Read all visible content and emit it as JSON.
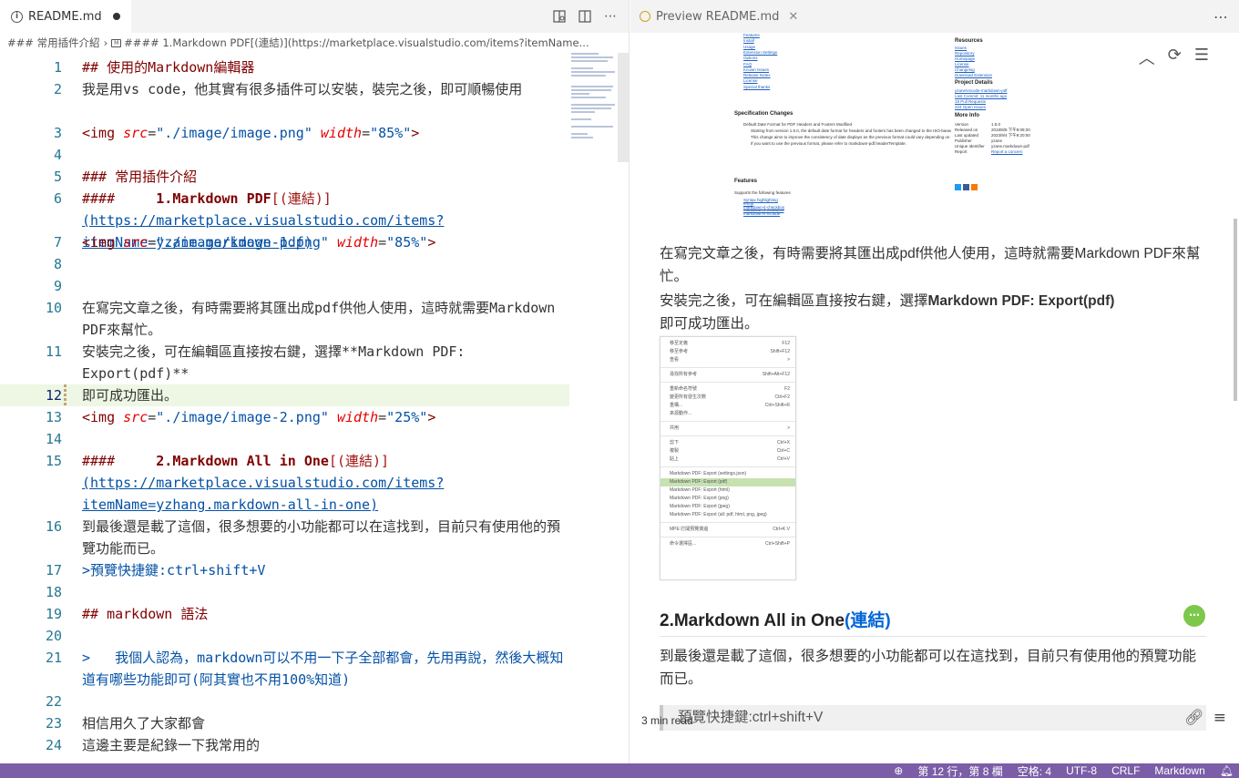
{
  "editor": {
    "tab_label": "README.md",
    "breadcrumb": {
      "part1": "### 常用插件介紹",
      "part2": "#### 1.Markdown PDF[(連結)](https://marketplace.visualstudio.com/items?itemName..."
    },
    "lines": [
      {
        "n": "1",
        "k": "## ",
        "t": "使用的Markdown編輯器"
      },
      {
        "n": "2",
        "t": "我是用vs code，他其實有很多插件可以安裝，裝完之後，即可順暢使用"
      },
      {
        "n": "3",
        "tag": "<img",
        "a1": "src",
        "v1": "\"./image/image.png\"",
        "a2": "width",
        "v2": "\"85%\"",
        "end": ">"
      },
      {
        "n": "4"
      },
      {
        "n": "5",
        "k": "### ",
        "t": "常用插件介紹"
      },
      {
        "n": "6",
        "k": "####     ",
        "h": "1.Markdown PDF",
        "lt": "[(連結)]",
        "url": "(https://marketplace.visualstudio.com/items?itemName=yzane.markdown-pdf)"
      },
      {
        "n": "7",
        "tag": "<img",
        "a1": "src",
        "v1": "\"./image/image-1.png\"",
        "a2": "width",
        "v2": "\"85%\"",
        "end": ">"
      },
      {
        "n": "8"
      },
      {
        "n": "9"
      },
      {
        "n": "10",
        "t": "在寫完文章之後，有時需要將其匯出成pdf供他人使用，這時就需要Markdown PDF來幫忙。"
      },
      {
        "n": "11",
        "t": "安裝完之後，可在編輯區直接按右鍵，選擇**Markdown PDF: Export(pdf)**"
      },
      {
        "n": "12",
        "t": "即可成功匯出。"
      },
      {
        "n": "13",
        "tag": "<img",
        "a1": "src",
        "v1": "\"./image/image-2.png\"",
        "a2": "width",
        "v2": "\"25%\"",
        "end": ">"
      },
      {
        "n": "14"
      },
      {
        "n": "15",
        "k": "####     ",
        "h": "2.Markdown All in One",
        "lt": "[(連結)]",
        "url": "(https://marketplace.visualstudio.com/items?itemName=yzhang.markdown-all-in-one)"
      },
      {
        "n": "16",
        "t": "到最後還是載了這個，很多想要的小功能都可以在這找到，目前只有使用他的預覽功能而已。"
      },
      {
        "n": "17",
        "q": ">預覽快捷鍵:ctrl+shift+V"
      },
      {
        "n": "18"
      },
      {
        "n": "19",
        "k": "## ",
        "t": "markdown 語法"
      },
      {
        "n": "20"
      },
      {
        "n": "21",
        "q": ">   我個人認為，markdown可以不用一下子全部都會，先用再說，然後大概知道有哪些功能即可(阿其實也不用100%知道)"
      },
      {
        "n": "22"
      },
      {
        "n": "23",
        "t": "相信用久了大家都會"
      },
      {
        "n": "24",
        "t": "這邊主要是紀錄一下我常用的"
      }
    ]
  },
  "preview": {
    "tab_label": "Preview README.md",
    "para1": "在寫完文章之後，有時需要將其匯出成pdf供他人使用，這時就需要Markdown PDF來幫忙。",
    "para2_prefix": "安裝完之後，可在編輯區直接按右鍵，選擇",
    "para2_bold": "Markdown PDF: Export(pdf)",
    "para3": "即可成功匯出。",
    "h2_text": "2.Markdown All in One",
    "h2_link": "(連結)",
    "para4": "到最後還是載了這個，很多想要的小功能都可以在這找到，目前只有使用他的預覽功能而已。",
    "quote": "預覽快捷鍵:ctrl+shift+V",
    "read_time": "3 min read",
    "ext_screenshot": {
      "nav_links": [
        "Features",
        "Install",
        "Usage",
        "Extension Settings",
        "Options",
        "FAQ",
        "Known Issues",
        "Release Notes",
        "License",
        "Special thanks"
      ],
      "spec_title": "Specification Changes",
      "spec_items": [
        "Default Date Format for PDF Headers and Footers Modified",
        "Starting from version 1.5.0, the default date format for headers and footers has been changed to the ISO-based format (YYYY-MM-DD).",
        "This change aims to improve the consistency of date displays as the previous format could vary depending on the environment.",
        "If you want to use the previous format, please refer to markdown-pdf.headerTemplate."
      ],
      "features_title": "Features",
      "features_intro": "Supports the following features",
      "features_items": [
        "Syntax highlighting",
        "emoji",
        "markdown-it-checkbox",
        "markdown-it-container",
        "markdown-it-include"
      ],
      "resources_title": "Resources",
      "resources": [
        "Issues",
        "Repository",
        "Homepage",
        "License",
        "Changelog",
        "Download Extension"
      ],
      "project_title": "Project Details",
      "project": [
        "yzane/vscode-markdown-pdf",
        "Last Commit: 11 months ago",
        "19 Pull Requests",
        "224 Open Issues"
      ],
      "more_title": "More Info",
      "more_info": [
        [
          "Version",
          "1.5.0"
        ],
        [
          "Released on",
          "2018/8/8 下午9:08:20"
        ],
        [
          "Last updated",
          "2023/9/4 下午9:20:00"
        ],
        [
          "Publisher",
          "yzane"
        ],
        [
          "Unique Identifier",
          "yzane.markdown-pdf"
        ],
        [
          "Report",
          "Report a concern"
        ]
      ]
    },
    "context_menu": [
      [
        "移至定義",
        "F12"
      ],
      [
        "移至參考",
        "Shift+F12"
      ],
      [
        "查看",
        ">"
      ],
      null,
      [
        "尋找所有參考",
        "Shift+Alt+F12"
      ],
      null,
      [
        "重新命名符號",
        "F2"
      ],
      [
        "變更所有發生次數",
        "Ctrl+F2"
      ],
      [
        "重構...",
        "Ctrl+Shift+R"
      ],
      [
        "來源動作...",
        ""
      ],
      null,
      [
        "共用",
        ">"
      ],
      null,
      [
        "剪下",
        "Ctrl+X"
      ],
      [
        "複製",
        "Ctrl+C"
      ],
      [
        "貼上",
        "Ctrl+V"
      ],
      null,
      [
        "Markdown PDF: Export (settings.json)",
        ""
      ],
      [
        "Markdown PDF: Export (pdf)",
        "",
        true
      ],
      [
        "Markdown PDF: Export (html)",
        ""
      ],
      [
        "Markdown PDF: Export (png)",
        ""
      ],
      [
        "Markdown PDF: Export (jpeg)",
        ""
      ],
      [
        "Markdown PDF: Export (all: pdf, html, png, jpeg)",
        ""
      ],
      null,
      [
        "MPE:打開預覽側邊",
        "Ctrl+K V"
      ],
      null,
      [
        "命令選擇區...",
        "Ctrl+Shift+P"
      ]
    ]
  },
  "statusbar": {
    "position": "第 12 行，第 8 欄",
    "spaces": "空格: 4",
    "encoding": "UTF-8",
    "eol": "CRLF",
    "language": "Markdown"
  },
  "colors": {
    "statusbar": "#7b5ea7",
    "current_line": "#eef7e4",
    "markdown_heading": "#800000",
    "link": "#0451a5"
  }
}
